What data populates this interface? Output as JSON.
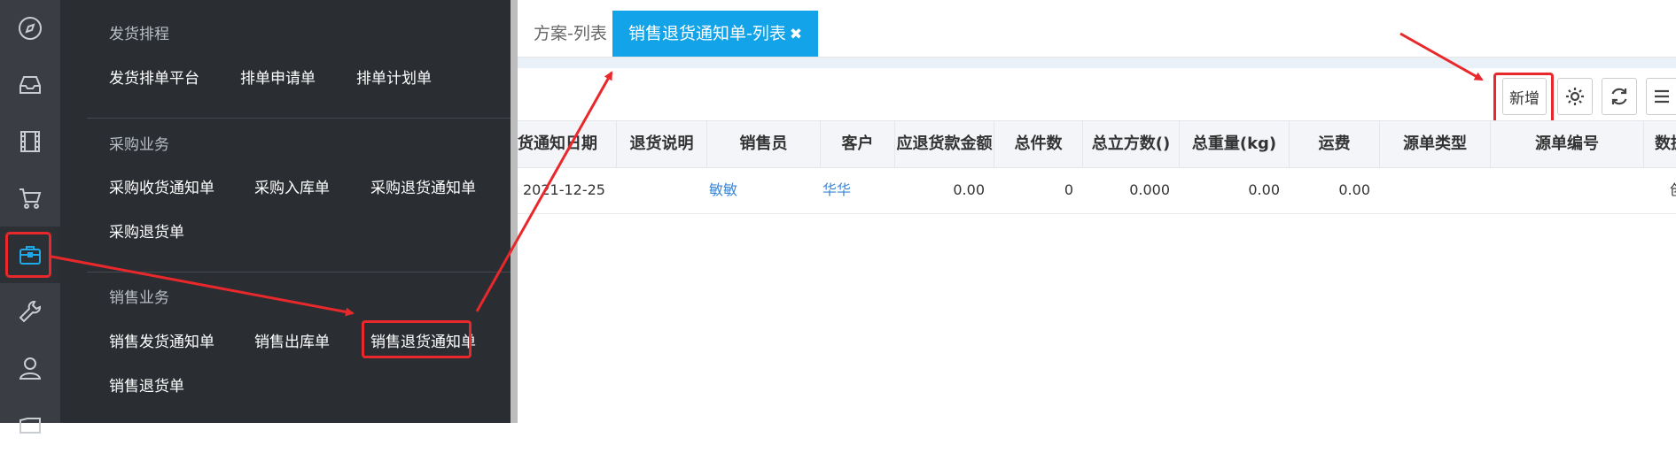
{
  "menu": {
    "sections": [
      {
        "title": "发货排程",
        "items": [
          "发货排单平台",
          "排单申请单",
          "排单计划单"
        ]
      },
      {
        "title": "采购业务",
        "items": [
          "采购收货通知单",
          "采购入库单",
          "采购退货通知单",
          "采购退货单"
        ]
      },
      {
        "title": "销售业务",
        "items": [
          "销售发货通知单",
          "销售出库单",
          "销售退货通知单",
          "销售退货单"
        ]
      }
    ]
  },
  "tabs": {
    "inactive_label": "方案-列表",
    "active_label": "销售退货通知单-列表",
    "close_glyph": "✖"
  },
  "toolbar": {
    "add_label": "新增"
  },
  "table": {
    "columns": [
      "货通知日期",
      "退货说明",
      "销售员",
      "客户",
      "应退货款金额",
      "总件数",
      "总立方数()",
      "总重量(kg)",
      "运费",
      "源单类型",
      "源单编号",
      "数据"
    ],
    "rows": [
      {
        "date": "2021-12-25",
        "desc": "",
        "salesperson": "敏敏",
        "customer": "华华",
        "amount": "0.00",
        "count": "0",
        "volume": "0.000",
        "weight": "0.00",
        "freight": "0.00",
        "src_type": "",
        "src_no": "",
        "data": "创"
      }
    ]
  },
  "colors": {
    "accent": "#12a3e8",
    "highlight": "#e8282b",
    "menu_bg": "#2a2e33",
    "rail_bg": "#3a3e44"
  },
  "icons": [
    "compass-icon",
    "inbox-icon",
    "film-icon",
    "cart-icon",
    "briefcase-icon",
    "wrench-icon",
    "user-icon",
    "folder-icon",
    "gear-icon",
    "refresh-icon",
    "menu-icon"
  ]
}
